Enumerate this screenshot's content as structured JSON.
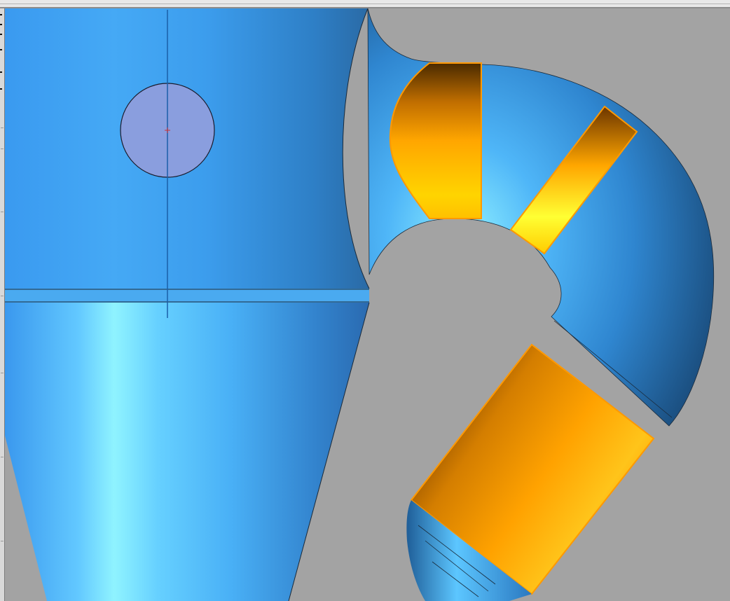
{
  "window": {
    "title": ""
  },
  "viewport": {
    "background": "#a3a3a3",
    "model": {
      "body_color": "#3b9cf0",
      "body_highlight": "#8ff3ff",
      "body_shadow": "#1b4f80",
      "selected_face_color": "#ffa600",
      "selected_face_highlight": "#ffe066",
      "selected_face_shadow": "#6b3500",
      "selection_outline": "#ff9900",
      "sketch_circle_fill": "#8a9ede",
      "edge_color": "#1a2a3a"
    },
    "icons": {
      "axis": "construction-axis-icon",
      "origin": "origin-marker-icon"
    }
  }
}
